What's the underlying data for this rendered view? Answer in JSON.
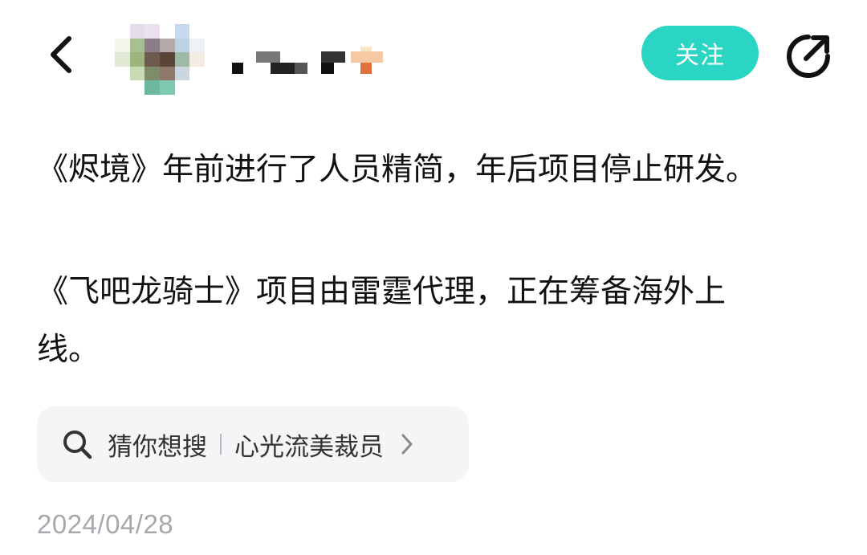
{
  "header": {
    "back_icon": "chevron-left-icon",
    "avatar": "pixelated-avatar",
    "username": "",
    "follow_label": "关注",
    "share_icon": "share-icon",
    "accent_color": "#2bd5c3"
  },
  "post": {
    "paragraphs": [
      "《烬境》年前进行了人员精简，年后项目停止研发。",
      "《飞吧龙骑士》项目由雷霆代理，正在筹备海外上线。"
    ],
    "date": "2024/04/28"
  },
  "search_suggestion": {
    "icon": "search-icon",
    "prefix": "猜你想搜",
    "query": "心光流美裁员",
    "chevron": "chevron-right-icon"
  }
}
